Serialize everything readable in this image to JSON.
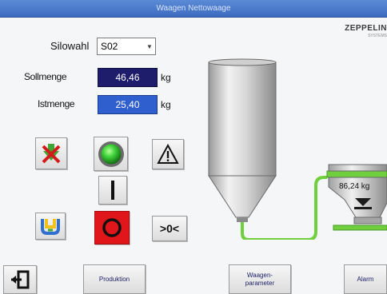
{
  "window": {
    "title": "Waagen Nettowaage"
  },
  "brand": {
    "name": "ZEPPELIN",
    "sub": "SYSTEMS"
  },
  "form": {
    "silo_label": "Silowahl",
    "silo_value": "S02",
    "soll_label": "Sollmenge",
    "soll_value": "46,46",
    "soll_unit": "kg",
    "ist_label": "Istmenge",
    "ist_value": "25,40",
    "ist_unit": "kg"
  },
  "controls": {
    "zero_label": ">0<",
    "status_lamp": "green",
    "stop_color": "#e0161b"
  },
  "scale": {
    "reading": "86,24 kg"
  },
  "bottom": {
    "exit_icon": "exit-icon",
    "produktion": "Produktion",
    "waagenparameter": "Waagen-\nparameter",
    "alarm": "Alarm"
  },
  "colors": {
    "title_bar": "#3d6cc0",
    "soll_field": "#1d1d6b",
    "ist_field": "#2f5fcf",
    "pipe": "#6fcf3c",
    "lamp": "#3fd23a"
  }
}
